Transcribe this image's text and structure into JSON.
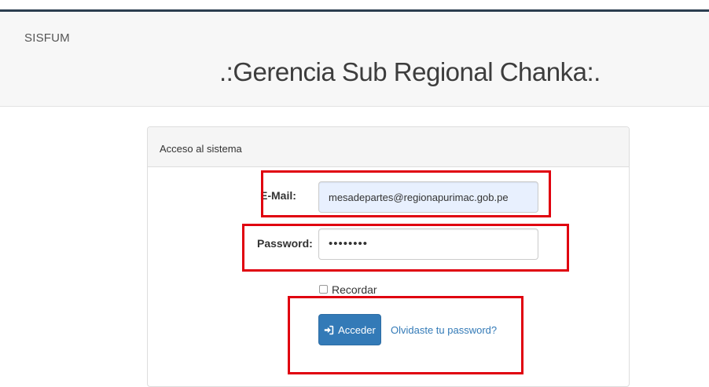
{
  "navbar": {
    "brand": "SISFUM",
    "heading": ".:Gerencia Sub Regional Chanka:."
  },
  "panel": {
    "title": "Acceso al sistema"
  },
  "form": {
    "email_label": "E-Mail:",
    "email_value": "mesadepartes@regionapurimac.gob.pe",
    "password_label": "Password:",
    "password_value": "••••••••",
    "remember_label": "Recordar",
    "remember_checked": false,
    "submit_label": "Acceder",
    "forgot_label": "Olvidaste tu password?"
  },
  "icons": {
    "submit": "sign-in-icon"
  },
  "colors": {
    "primary": "#337ab7",
    "highlight": "#e0000f",
    "autofill": "#e8f0fe"
  }
}
